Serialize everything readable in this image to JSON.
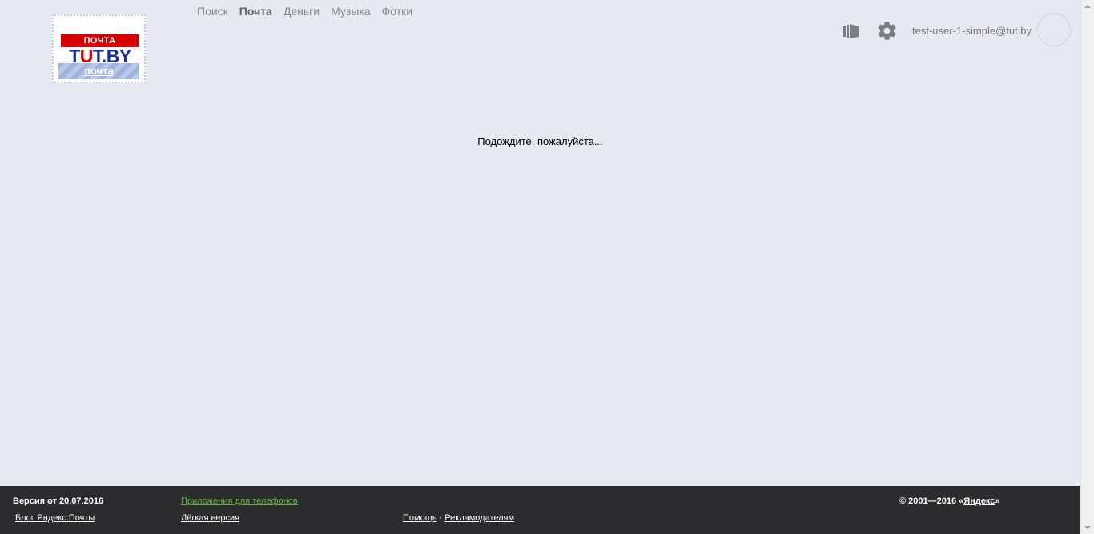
{
  "logo": {
    "top_label": "ПОЧТА",
    "brand": "TUT.BY",
    "bottom_label": "почта"
  },
  "nav": {
    "items": [
      {
        "label": "Поиск",
        "active": false
      },
      {
        "label": "Почта",
        "active": true
      },
      {
        "label": "Деньги",
        "active": false
      },
      {
        "label": "Музыка",
        "active": false
      },
      {
        "label": "Фотки",
        "active": false
      }
    ]
  },
  "header": {
    "user_email": "test-user-1-simple@tut.by",
    "icons": [
      "compose-icon",
      "gear-icon"
    ]
  },
  "main": {
    "loading_text": "Подождите, пожалуйста..."
  },
  "footer": {
    "version": "Версия от 20.07.2016",
    "apps_link": "Приложения для телефонов",
    "copyright_prefix": "© 2001—2016 «",
    "copyright_link": "Яндекс",
    "copyright_suffix": "»",
    "blog_link": "Блог Яндекс.Почты",
    "light_link": "Лёгкая версия",
    "help_link": "Помощь",
    "separator": " · ",
    "ads_link": "Рекламодателям"
  },
  "colors": {
    "background": "#e6e9f1",
    "footer_bg": "#2c2c2e",
    "apps_link": "#5eb43a",
    "brand_red": "#d60000",
    "brand_blue": "#1a2f9a"
  }
}
